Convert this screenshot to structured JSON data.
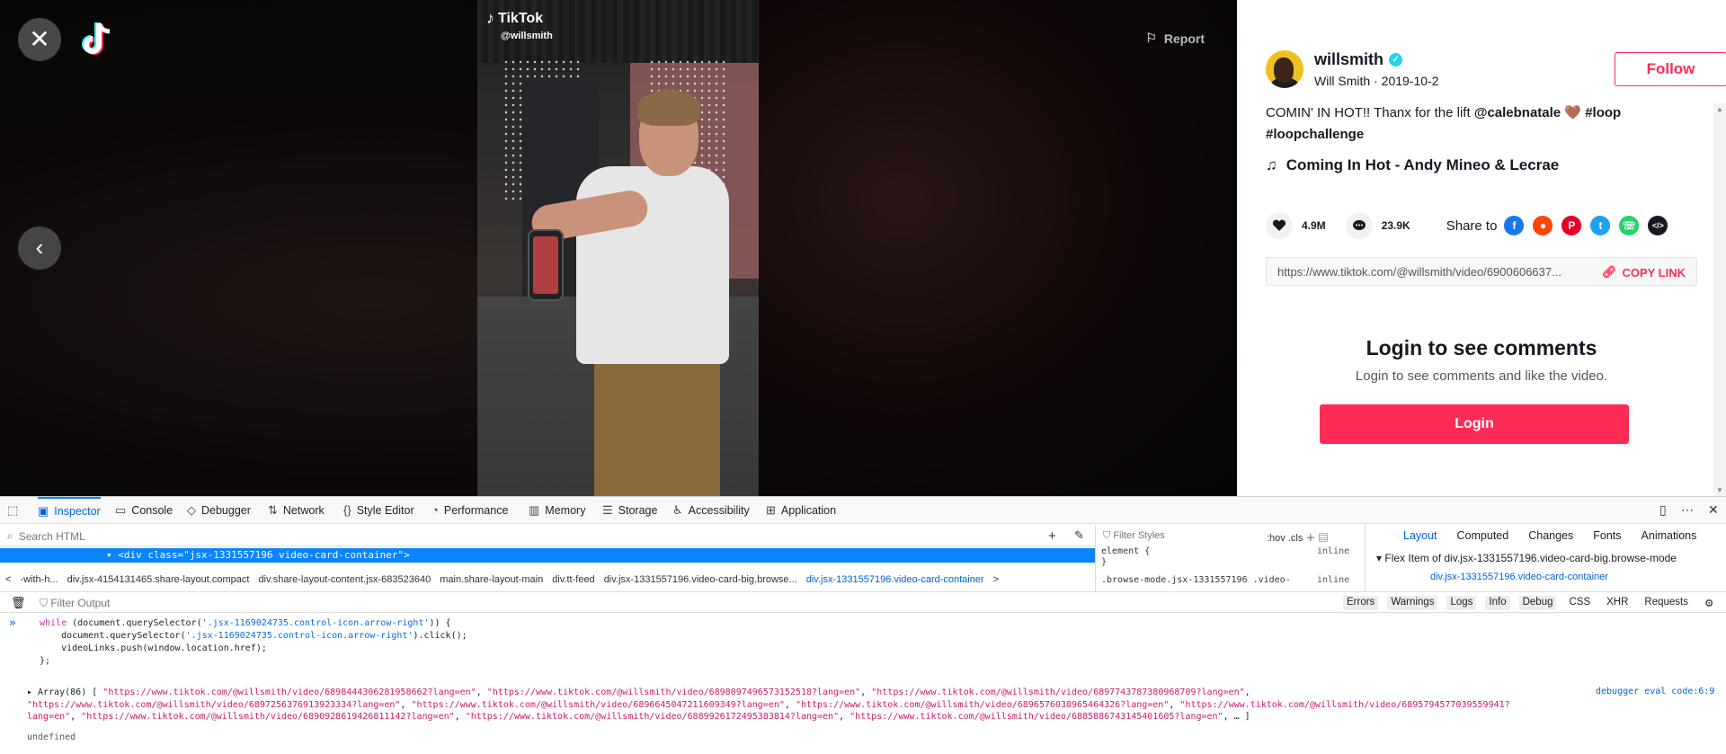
{
  "video": {
    "brand": "TikTok",
    "handle": "@willsmith",
    "report_label": "Report"
  },
  "author": {
    "username": "willsmith",
    "display_line": "Will Smith · 2019-10-2",
    "follow_label": "Follow"
  },
  "caption": {
    "text": "COMIN' IN HOT!! Thanx for the lift",
    "mention": "@calebnatale",
    "emoji": "🤎",
    "tag1": "#loop",
    "tag2": "#loopchallenge"
  },
  "music": "Coming In Hot - Andy Mineo & Lecrae",
  "stats": {
    "likes": "4.9M",
    "comments": "23.9K",
    "share_label": "Share to"
  },
  "share_targets": [
    "facebook-icon",
    "reddit-icon",
    "pinterest-icon",
    "twitter-icon",
    "whatsapp-icon",
    "embed-icon"
  ],
  "link": {
    "url": "https://www.tiktok.com/@willsmith/video/6900606637...",
    "copy_label": "COPY LINK"
  },
  "login": {
    "title": "Login to see comments",
    "subtitle": "Login to see comments and like the video.",
    "button": "Login"
  },
  "devtools": {
    "tabs": [
      "Inspector",
      "Console",
      "Debugger",
      "Network",
      "Style Editor",
      "Performance",
      "Memory",
      "Storage",
      "Accessibility",
      "Application"
    ],
    "search_html_placeholder": "Search HTML",
    "selected_line": "<div class=\"jsx-1331557196 video-card-container\">",
    "breadcrumbs": [
      "-with-h...",
      "div.jsx-4154131465.share-layout.compact",
      "div.share-layout-content.jsx-683523640",
      "main.share-layout-main",
      "div.tt-feed",
      "div.jsx-1331557196.video-card-big.browse...",
      "div.jsx-1331557196.video-card-container"
    ],
    "filter_styles": "Filter Styles",
    "hov": ":hov",
    "cls": ".cls",
    "element_rule": "element {",
    "element_rule_close": "}",
    "browse_rule": ".browse-mode.jsx-1331557196 .video-",
    "inline": "inline",
    "layout_tabs": [
      "Layout",
      "Computed",
      "Changes",
      "Fonts",
      "Animations"
    ],
    "flex_item": "Flex Item of div.jsx-1331557196.video-card-big.browse-mode",
    "flex_selector": "div.jsx-1331557196.video-card-container",
    "filter_output": "Filter Output",
    "console_filters": [
      "Errors",
      "Warnings",
      "Logs",
      "Info",
      "Debug"
    ],
    "console_filters_plain": [
      "CSS",
      "XHR",
      "Requests"
    ],
    "code_line1_a": "while",
    "code_line1_b": " (document.querySelector(",
    "code_line1_c": "'.jsx-1169024735.control-icon.arrow-right'",
    "code_line1_d": ")) {",
    "code_line2_a": "    document.querySelector(",
    "code_line2_b": "'.jsx-1169024735.control-icon.arrow-right'",
    "code_line2_c": ").click();",
    "code_line3": "    videoLinks.push(window.location.href);",
    "code_line4": "};",
    "result_prefix": "▸ Array(86) [ ",
    "result_urls": [
      "\"https://www.tiktok.com/@willsmith/video/6898444306281958662?lang=en\"",
      "\"https://www.tiktok.com/@willsmith/video/6898097496573152518?lang=en\"",
      "\"https://www.tiktok.com/@willsmith/video/6897743787380968709?lang=en\"",
      "\"https://www.tiktok.com/@willsmith/video/6897256376913923334?lang=en\"",
      "\"https://www.tiktok.com/@willsmith/video/6896645047211609349?lang=en\"",
      "\"https://www.tiktok.com/@willsmith/video/6896576038965464326?lang=en\"",
      "\"https://www.tiktok.com/@willsmith/video/6895794577039559941?lang=en\"",
      "\"https://www.tiktok.com/@willsmith/video/6890928619426811142?lang=en\"",
      "\"https://www.tiktok.com/@willsmith/video/6889926172495383814?lang=en\"",
      "\"https://www.tiktok.com/@willsmith/video/6885886743145401605?lang=en\""
    ],
    "result_suffix": ", … ]",
    "result_source": "debugger eval code:6:9",
    "undefined": "undefined"
  }
}
